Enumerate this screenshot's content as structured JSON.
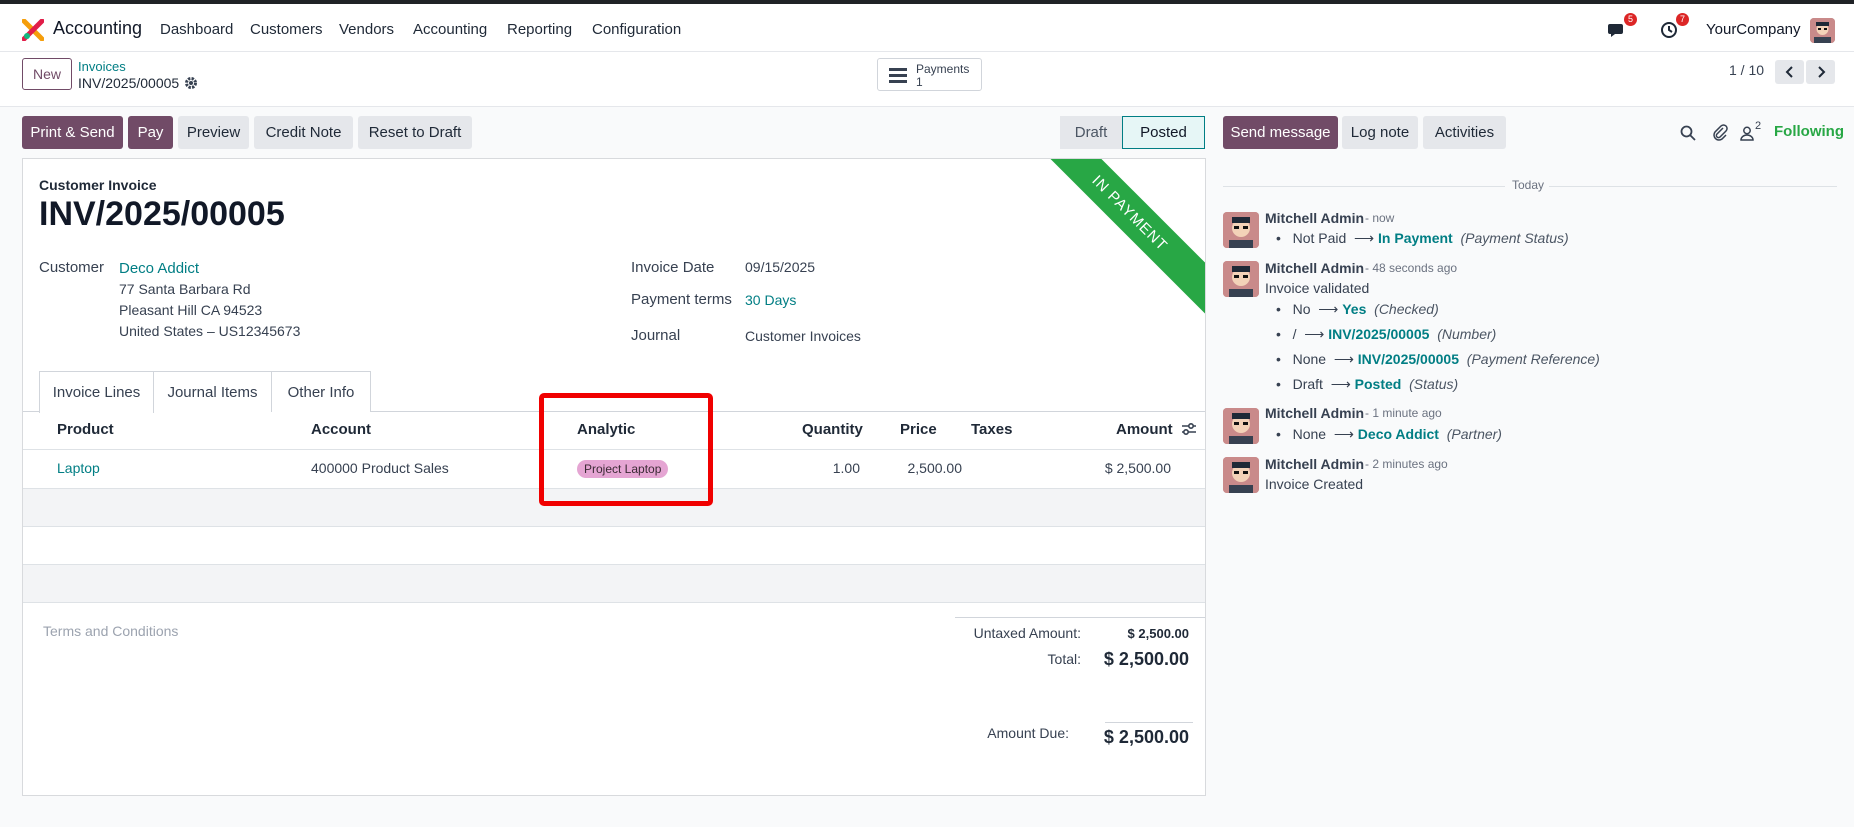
{
  "navbar": {
    "app_name": "Accounting",
    "menu": [
      "Dashboard",
      "Customers",
      "Vendors",
      "Accounting",
      "Reporting",
      "Configuration"
    ],
    "messages_badge": "5",
    "activities_badge": "7",
    "company": "YourCompany"
  },
  "control": {
    "new_label": "New",
    "breadcrumb_parent": "Invoices",
    "breadcrumb_current": "INV/2025/00005",
    "payments_label": "Payments",
    "payments_count": "1",
    "pager": "1 / 10"
  },
  "actions": {
    "print_send": "Print & Send",
    "pay": "Pay",
    "preview": "Preview",
    "credit_note": "Credit Note",
    "reset_to_draft": "Reset to Draft"
  },
  "status": {
    "draft": "Draft",
    "posted": "Posted"
  },
  "invoice": {
    "type": "Customer Invoice",
    "number": "INV/2025/00005",
    "ribbon": "IN PAYMENT",
    "customer_label": "Customer",
    "customer": "Deco Addict",
    "address1": "77 Santa Barbara Rd",
    "address2": "Pleasant Hill CA 94523",
    "address3": "United States – US12345673",
    "invoice_date_label": "Invoice Date",
    "invoice_date": "09/15/2025",
    "payment_terms_label": "Payment terms",
    "payment_terms": "30 Days",
    "journal_label": "Journal",
    "journal": "Customer Invoices"
  },
  "tabs": [
    "Invoice Lines",
    "Journal Items",
    "Other Info"
  ],
  "lines": {
    "headers": {
      "product": "Product",
      "account": "Account",
      "analytic": "Analytic",
      "quantity": "Quantity",
      "price": "Price",
      "taxes": "Taxes",
      "amount": "Amount"
    },
    "rows": [
      {
        "product": "Laptop",
        "account": "400000 Product Sales",
        "analytic": "Project Laptop",
        "quantity": "1.00",
        "price": "2,500.00",
        "taxes": "",
        "amount": "$ 2,500.00"
      }
    ]
  },
  "totals": {
    "terms_placeholder": "Terms and Conditions",
    "untaxed_label": "Untaxed Amount:",
    "untaxed": "$ 2,500.00",
    "total_label": "Total:",
    "total": "$ 2,500.00",
    "due_label": "Amount Due:",
    "due": "$ 2,500.00"
  },
  "chatter": {
    "send_message": "Send message",
    "log_note": "Log note",
    "activities": "Activities",
    "followers_count": "2",
    "following": "Following",
    "today": "Today",
    "messages": [
      {
        "author": "Mitchell Admin",
        "time": "- now",
        "changes": [
          {
            "from": "Not Paid",
            "to": "In Payment",
            "field": "(Payment Status)"
          }
        ]
      },
      {
        "author": "Mitchell Admin",
        "time": "- 48 seconds ago",
        "body": "Invoice validated",
        "changes": [
          {
            "from": "No",
            "to": "Yes",
            "field": "(Checked)"
          },
          {
            "from": "/",
            "to": "INV/2025/00005",
            "field": "(Number)"
          },
          {
            "from": "None",
            "to": "INV/2025/00005",
            "field": "(Payment Reference)"
          },
          {
            "from": "Draft",
            "to": "Posted",
            "field": "(Status)"
          }
        ]
      },
      {
        "author": "Mitchell Admin",
        "time": "- 1 minute ago",
        "changes": [
          {
            "from": "None",
            "to": "Deco Addict",
            "field": "(Partner)"
          }
        ]
      },
      {
        "author": "Mitchell Admin",
        "time": "- 2 minutes ago",
        "body": "Invoice Created"
      }
    ]
  },
  "colors": {
    "primary": "#714b67",
    "link": "#017e84",
    "ribbon": "#28a745",
    "highlight": "#f00000"
  }
}
